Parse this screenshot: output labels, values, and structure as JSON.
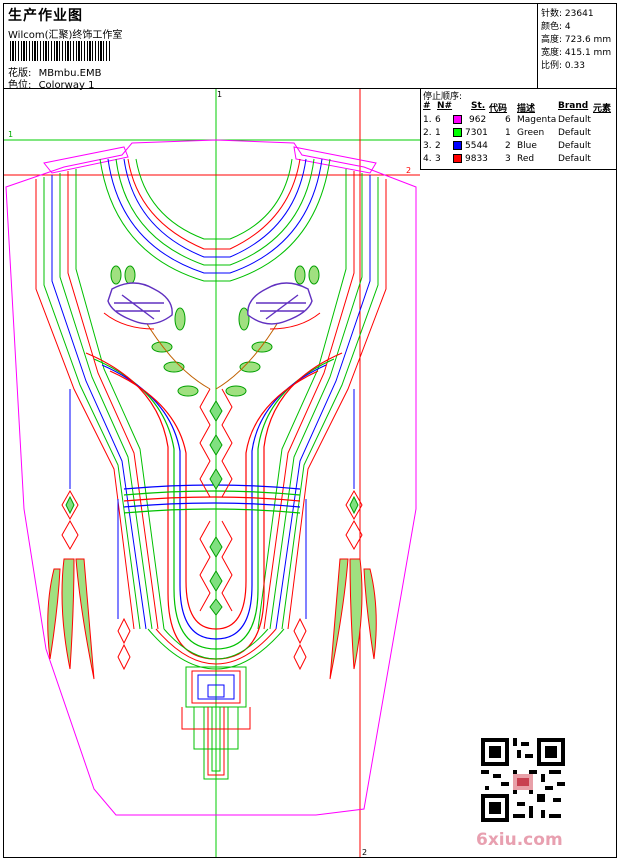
{
  "header": {
    "title": "生产作业图",
    "company": "Wilcom(汇聚)终饰工作室",
    "design_label": "花版:",
    "design_value": "MBmbu.EMB",
    "colorway_label": "色位:",
    "colorway_value": "Colorway 1"
  },
  "stats": [
    {
      "label": "针数:",
      "value": "23641"
    },
    {
      "label": "颜色:",
      "value": "4"
    },
    {
      "label": "高度:",
      "value": "723.6 mm"
    },
    {
      "label": "宽度:",
      "value": "415.1 mm"
    },
    {
      "label": "比例:",
      "value": "0.33"
    }
  ],
  "legend": {
    "caption": "停止顺序:",
    "headers": [
      "#",
      "N#",
      "St.",
      "代码",
      "描述",
      "Brand",
      "元素"
    ],
    "rows": [
      {
        "index": "1.",
        "n": "6",
        "color": "#ff00ff",
        "stitches": "962",
        "code": "6",
        "desc": "Magenta",
        "brand": "Default"
      },
      {
        "index": "2.",
        "n": "1",
        "color": "#00ff00",
        "stitches": "7301",
        "code": "1",
        "desc": "Green",
        "brand": "Default"
      },
      {
        "index": "3.",
        "n": "2",
        "color": "#0000ff",
        "stitches": "5544",
        "code": "2",
        "desc": "Blue",
        "brand": "Default"
      },
      {
        "index": "4.",
        "n": "3",
        "color": "#ff0000",
        "stitches": "9833",
        "code": "3",
        "desc": "Red",
        "brand": "Default"
      }
    ]
  },
  "guides": {
    "marker_1": "1",
    "marker_2": "2"
  },
  "watermark": "6xiu.com",
  "colors": {
    "magenta": "#ff00ff",
    "green": "#00c000",
    "blue": "#0000ff",
    "red": "#ff0000",
    "guide_green": "#00cc00",
    "guide_red": "#ff0000"
  }
}
